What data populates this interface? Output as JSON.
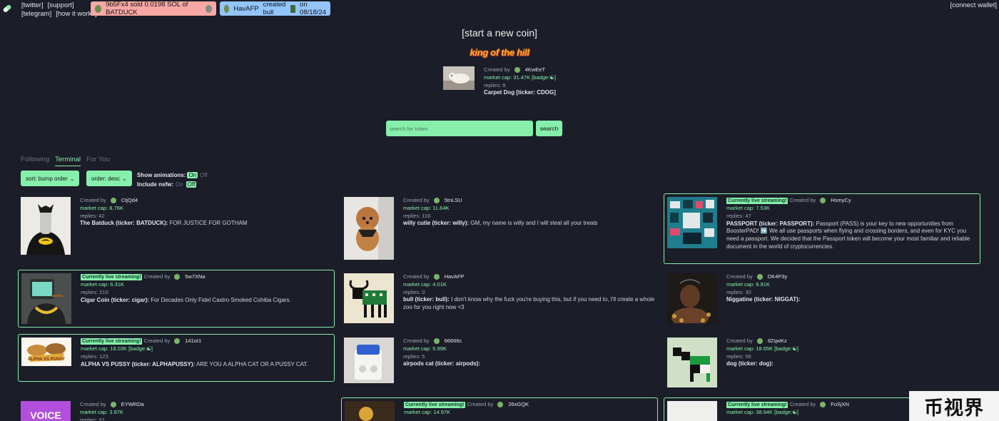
{
  "header": {
    "links_row1": [
      "[twitter]",
      "[support]"
    ],
    "links_row2": [
      "[telegram]",
      "[how it works]"
    ],
    "ticker_sell": {
      "text": "9b5Fx4  sold 0.0198 SOL of BATDUCK",
      "color": "#f8a8a4"
    },
    "ticker_create": {
      "user": "HavAFP",
      "text_mid": "created bull",
      "text_end": "on 08/18/24",
      "color": "#93c5fd"
    },
    "connect_wallet": "[connect wallet]"
  },
  "start_new_coin": "[start a new coin]",
  "king_of_the_hill": {
    "title": "king of the hill",
    "created_by_label": "Created by",
    "creator": "4KwEeT",
    "market_cap_label": "market cap:",
    "market_cap": "31.47K",
    "badge": "[badge:",
    "badge_end": "]",
    "replies_label": "replies:",
    "replies": "8",
    "name": "Carpet Dog [ticker: CDOG]"
  },
  "search": {
    "placeholder": "search for token",
    "button": "search"
  },
  "tabs": [
    "Following",
    "Terminal",
    "For You"
  ],
  "controls": {
    "sort": "sort: bump order",
    "order": "order: desc",
    "show_animations_label": "Show animations:",
    "include_nsfw_label": "Include nsfw:",
    "on": "On",
    "off": "Off"
  },
  "labels": {
    "live": "Currently live streaming!",
    "created_by": "Created by",
    "market_cap": "market cap:",
    "replies": "replies:",
    "badge": "[badge:",
    "badge_end": "]"
  },
  "coins": [
    {
      "creator": "CtjQd4",
      "market_cap": "8.76K",
      "replies": "42",
      "name": "The Batduck (ticker: BATDUCK):",
      "desc": "FOR JUSTICE FOR GOTHAM"
    },
    {
      "creator": "5tnLSU",
      "market_cap": "11.64K",
      "replies": "116",
      "name": "willy cutie (ticker: willy):",
      "desc": "GM, my name is willy and I will steal all your treats"
    },
    {
      "creator": "HsmyCy",
      "market_cap": "7.53K",
      "replies": "47",
      "name": "PASSPORT (ticker: PASSPORT):",
      "desc": "Passport (PASS) is your key to new opportunities from BoosterPAD! ➡️ We all use passports when flying and crossing borders, and even for KYC you need a passport. We decided that the Passport token will become your most familiar and reliable document in the world of cryptocurrencies."
    },
    {
      "creator": "5w7XNa",
      "market_cap": "6.31K",
      "replies": "210",
      "name": "Cigar Coin (ticker: cigar):",
      "desc": "For Decades Only Fidel Castro Smoked Cohiba Cigars."
    },
    {
      "creator": "HavAFP",
      "market_cap": "4.01K",
      "replies": "0",
      "name": "bull (ticker: bull):",
      "desc": "I don't know why the fuck you're buying this, but if you need to, I'll create a whole zoo for you right now <3"
    },
    {
      "creator": "DK4P3y",
      "market_cap": "9.91K",
      "replies": "30",
      "name": "Niggatine (ticker: NIGGAT):",
      "desc": ""
    },
    {
      "creator": "141oI1",
      "market_cap": "18.03K",
      "replies": "123",
      "name": "ALPHA VS PUSSY (ticker: ALPHAPUSSY):",
      "desc": "ARE YOU A ALPHA CAT OR A PUSSY CAT."
    },
    {
      "creator": "66666c",
      "market_cap": "5.99K",
      "replies": "5",
      "name": "airpods cat (ticker: airpods):",
      "desc": ""
    },
    {
      "creator": "9ZqwKz",
      "market_cap": "18.65K",
      "replies": "58",
      "name": "dog (ticker: dog):",
      "desc": ""
    },
    {
      "creator": "EYWRDa",
      "market_cap": "3.97K",
      "replies": "32"
    },
    {
      "creator": "26xGQK",
      "market_cap": "14.97K"
    },
    {
      "creator": "FoSjXN",
      "market_cap": "38.64K"
    }
  ],
  "thumb_texts": {
    "voice": "VOICE",
    "alpha": "ALPHA VS PUSSY"
  },
  "watermark": "币视界"
}
